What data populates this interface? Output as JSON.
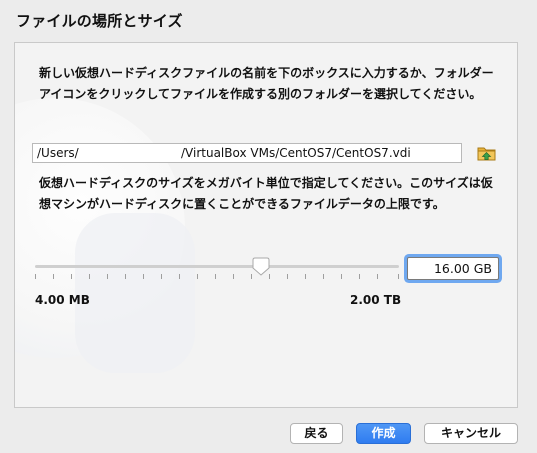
{
  "window": {
    "title": "ファイルの場所とサイズ"
  },
  "location": {
    "description": "新しい仮想ハードディスクファイルの名前を下のボックスに入力するか、フォルダーアイコンをクリックしてファイルを作成する別のフォルダーを選択してください。",
    "path_start": "/Users/",
    "path_end": "/VirtualBox VMs/CentOS7/CentOS7.vdi",
    "folder_icon": "folder-with-up-arrow-icon"
  },
  "size": {
    "description": "仮想ハードディスクのサイズをメガバイト単位で指定してください。このサイズは仮想マシンがハードディスクに置くことができるファイルデータの上限です。",
    "value": "16.00 GB",
    "slider_position": 0.62,
    "min_label": "4.00 MB",
    "max_label": "2.00 TB"
  },
  "buttons": {
    "back": "戻る",
    "create": "作成",
    "cancel": "キャンセル"
  },
  "colors": {
    "primary_button": "#2f7cf0",
    "focus_ring": "#6fa8f0"
  }
}
